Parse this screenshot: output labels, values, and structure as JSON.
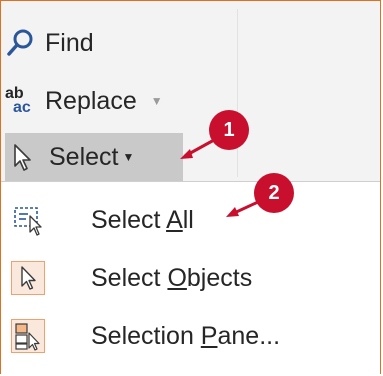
{
  "ribbon": {
    "find_label": "Find",
    "replace_label": "Replace",
    "select_label": "Select",
    "replace_icon_text_top": "ab",
    "replace_icon_text_bottom": "ac"
  },
  "menu": {
    "items": [
      {
        "label_before": "Select ",
        "label_underlined": "A",
        "label_after": "ll",
        "icon": "select-all-icon"
      },
      {
        "label_before": "Select ",
        "label_underlined": "O",
        "label_after": "bjects",
        "icon": "select-objects-icon"
      },
      {
        "label_before": "Selection ",
        "label_underlined": "P",
        "label_after": "ane...",
        "icon": "selection-pane-icon"
      }
    ]
  },
  "callouts": {
    "first": "1",
    "second": "2"
  },
  "colors": {
    "accent": "#c8102e",
    "frame": "#e0701f",
    "icon_blue": "#2b579a",
    "highlight": "#c9c9c9"
  }
}
